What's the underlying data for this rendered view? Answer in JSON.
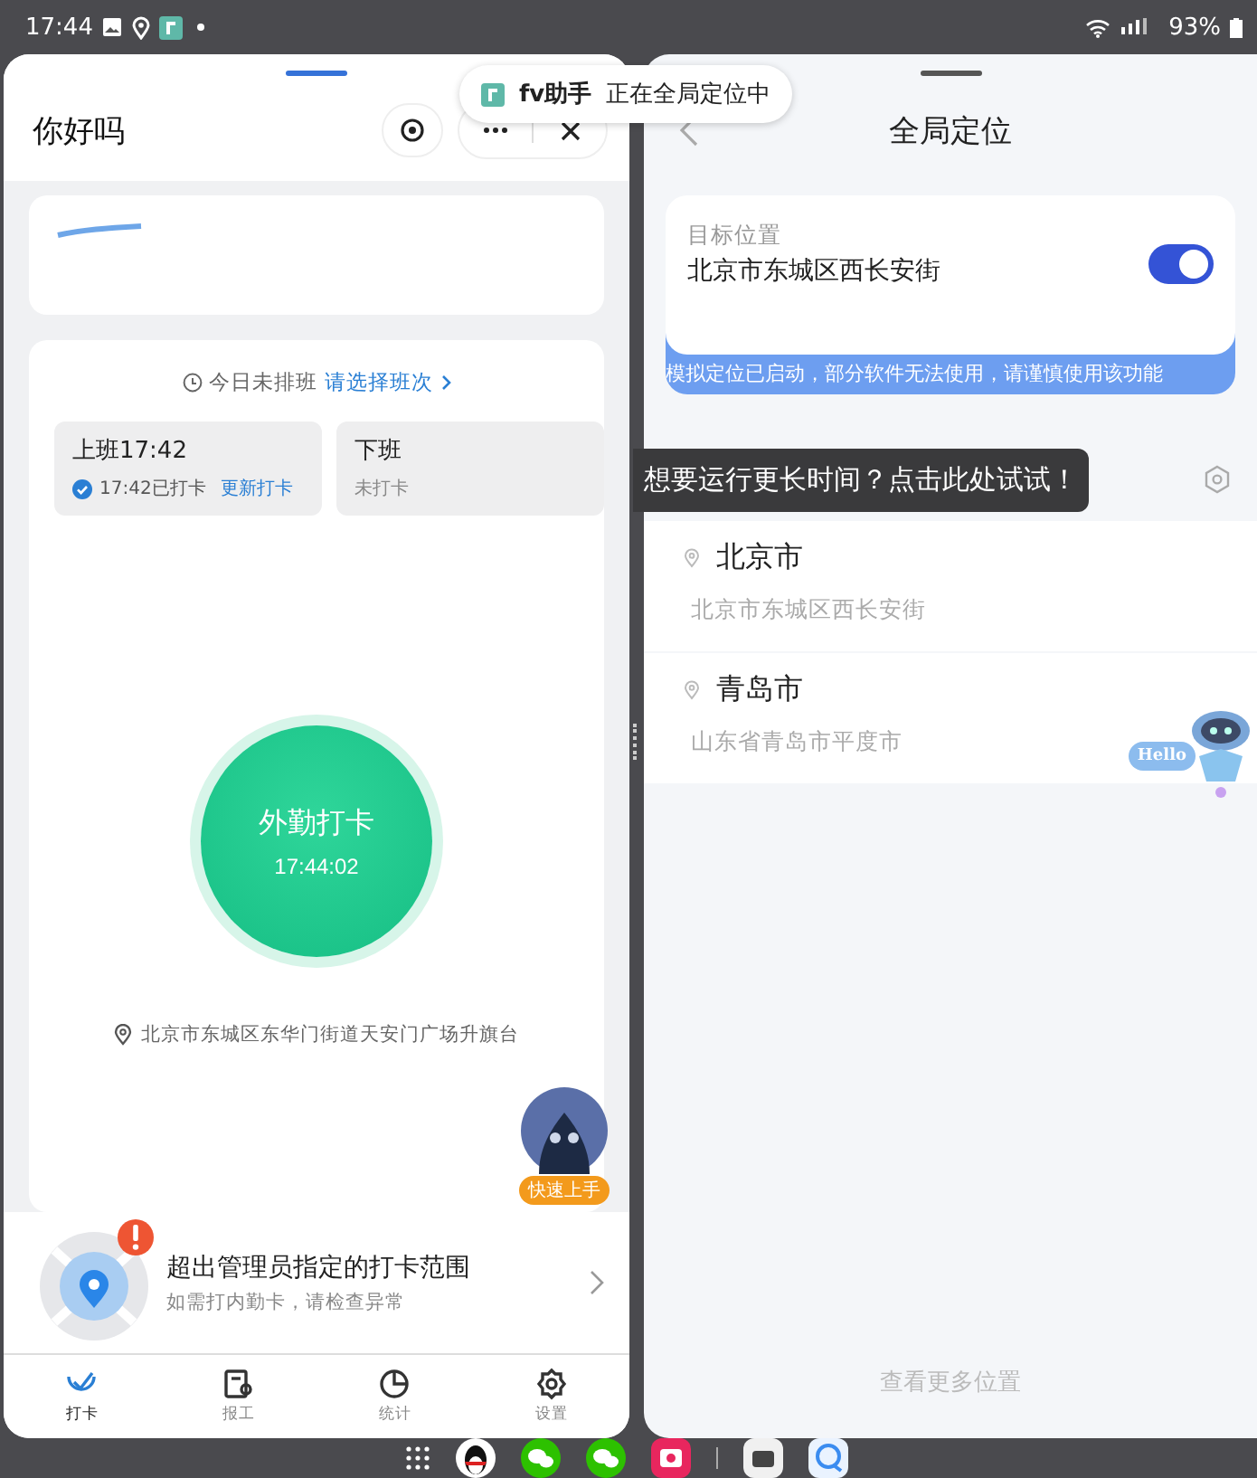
{
  "status_bar": {
    "time": "17:44",
    "battery": "93%"
  },
  "notification": {
    "app": "fv助手",
    "message": "正在全局定位中"
  },
  "left_app": {
    "title": "你好吗",
    "schedule": {
      "notice": "今日未排班",
      "link": "请选择班次"
    },
    "shifts": [
      {
        "label": "上班17:42",
        "status": "17:42已打卡",
        "action": "更新打卡",
        "punched": true
      },
      {
        "label": "下班",
        "status": "未打卡",
        "punched": false
      }
    ],
    "punch_button": {
      "label": "外勤打卡",
      "time": "17:44:02"
    },
    "location": "北京市东城区东华门街道天安门广场升旗台",
    "helper_badge": "快速上手",
    "alert": {
      "title": "超出管理员指定的打卡范围",
      "subtitle": "如需打内勤卡，请检查异常"
    },
    "tabs": [
      {
        "label": "打卡",
        "selected": true
      },
      {
        "label": "报工",
        "selected": false
      },
      {
        "label": "统计",
        "selected": false
      },
      {
        "label": "设置",
        "selected": false
      }
    ]
  },
  "right_app": {
    "title": "全局定位",
    "target": {
      "label": "目标位置",
      "address": "北京市东城区西长安街",
      "enabled": true
    },
    "warning": "模拟定位已启动，部分软件无法使用，请谨慎使用该功能",
    "tooltip": "想要运行更长时间？点击此处试试！",
    "locations": [
      {
        "name": "北京市",
        "address": "北京市东城区西长安街"
      },
      {
        "name": "青岛市",
        "address": "山东省青岛市平度市"
      }
    ],
    "robot_label": "Hello",
    "more_link": "查看更多位置"
  }
}
